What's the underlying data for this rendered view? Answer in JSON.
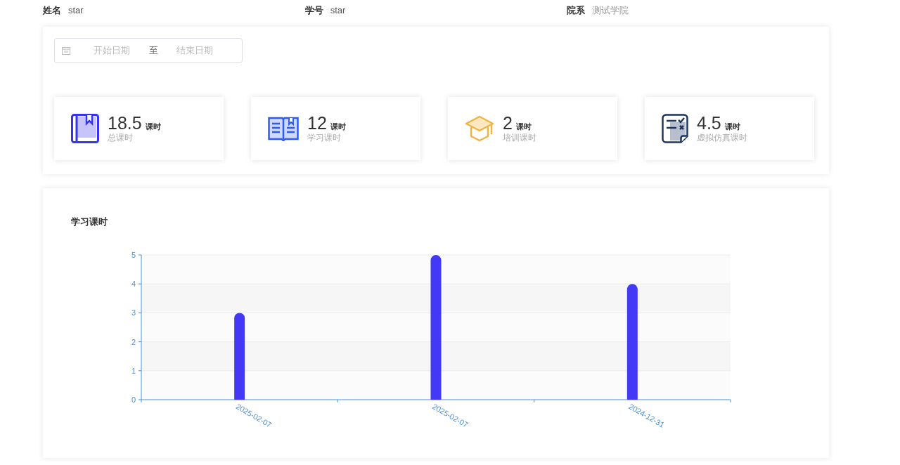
{
  "profile": [
    {
      "label": "姓名",
      "value": "star",
      "muted": false
    },
    {
      "label": "学号",
      "value": "star",
      "muted": false
    },
    {
      "label": "院系",
      "value": "测试学院",
      "muted": true
    }
  ],
  "date_range": {
    "start_placeholder": "开始日期",
    "separator": "至",
    "end_placeholder": "结束日期"
  },
  "stats": [
    {
      "value": "18.5",
      "unit": "课时",
      "label": "总课时"
    },
    {
      "value": "12",
      "unit": "课时",
      "label": "学习课时"
    },
    {
      "value": "2",
      "unit": "课时",
      "label": "培训课时"
    },
    {
      "value": "4.5",
      "unit": "课时",
      "label": "虚拟仿真课时"
    }
  ],
  "chart_panel": {
    "chart_data": {
      "type": "bar",
      "title": "学习课时",
      "grid": true,
      "categories": [
        "2025-02-07",
        "2025-02-07",
        "2024-12-31"
      ],
      "series": [
        {
          "color": "#4338f5",
          "values": [
            3,
            5,
            4
          ]
        }
      ],
      "ylim": [
        0,
        5
      ],
      "yticks": [
        0,
        1,
        2,
        3,
        4,
        5
      ]
    }
  }
}
